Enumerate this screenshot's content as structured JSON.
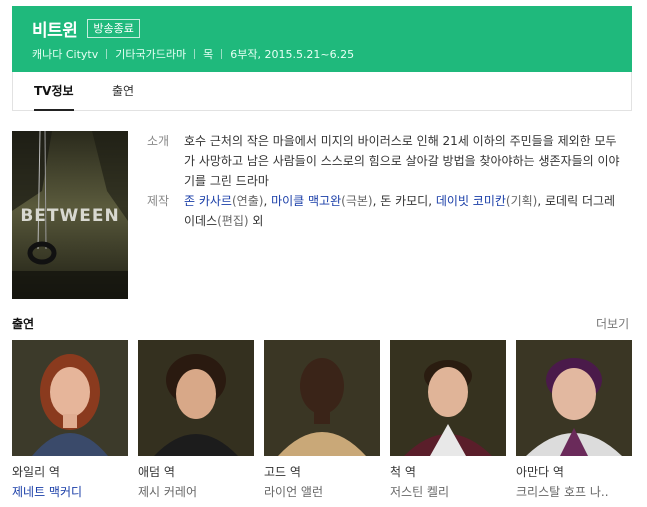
{
  "header": {
    "title": "비트윈",
    "badge": "방송종료",
    "meta": [
      "캐나다 Citytv",
      "기타국가드라마",
      "목",
      "6부작, 2015.5.21~6.25"
    ],
    "color": "#1fb97c"
  },
  "tabs": [
    {
      "label": "TV정보",
      "active": true
    },
    {
      "label": "출연",
      "active": false
    }
  ],
  "poster": {
    "logo_text": "BETWEEN"
  },
  "info": {
    "intro_label": "소개",
    "intro_text": "호수 근처의 작은 마을에서 미지의 바이러스로 인해 21세 이하의 주민들을 제외한 모두가 사망하고 남은 사람들이 스스로의 힘으로 살아갈 방법을 찾아야하는 생존자들의 이야기를 그린 드라마",
    "staff_label": "제작",
    "staff": [
      {
        "name": "존 카사르",
        "role": "(연출)",
        "sep": ", "
      },
      {
        "name": "마이클 맥고완",
        "role": "(극본)",
        "sep": ", "
      },
      {
        "name": "돈 카모디",
        "role": "",
        "sep": ", "
      },
      {
        "name": "데이빗 코미칸",
        "role": "(기획)",
        "sep": ", "
      },
      {
        "name": "로데릭 더그레이데스",
        "role": "(편집)",
        "sep": " 외"
      }
    ]
  },
  "cast_section": {
    "title": "출연",
    "more": "더보기"
  },
  "cast": [
    {
      "role": "와일리 역",
      "actor": "제네트 맥커디",
      "linked": true,
      "icon": "actress-portrait-redhair"
    },
    {
      "role": "애덤 역",
      "actor": "제시 커레어",
      "linked": false,
      "icon": "actor-portrait-curly"
    },
    {
      "role": "고드 역",
      "actor": "라이언 앨런",
      "linked": false,
      "icon": "actor-portrait-bald"
    },
    {
      "role": "척 역",
      "actor": "저스틴 켈리",
      "linked": false,
      "icon": "actor-portrait-jacket"
    },
    {
      "role": "아만다 역",
      "actor": "크리스탈 호프 나..",
      "linked": false,
      "icon": "actress-portrait-purple"
    }
  ]
}
